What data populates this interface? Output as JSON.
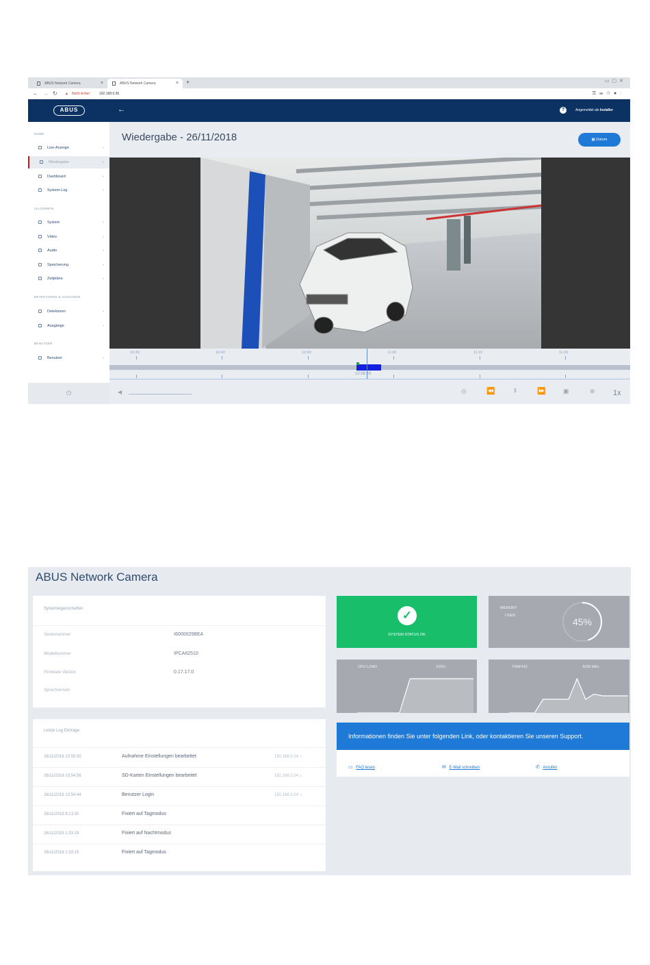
{
  "browser": {
    "tabs": [
      {
        "label": "ABUS Network Camera",
        "close": "×"
      },
      {
        "label": "ABUS Network Camera",
        "close": "×"
      }
    ],
    "new_tab": "+",
    "insecure_label": "Nicht sicher",
    "url": "192.168.0.36"
  },
  "app": {
    "logo_text": "ABUS",
    "user_prefix": "Angemeldet als",
    "user_name": "Installer",
    "help_icon": "?",
    "page_title": "Wiedergabe - 26/11/2018",
    "date_button": "Datum",
    "sidebar": {
      "sections": [
        {
          "title": "HOME",
          "items": [
            "Live-Anzeige",
            "Wiedergabe",
            "Dashboard",
            "System-Log"
          ]
        },
        {
          "title": "ALLGEMEIN",
          "items": [
            "System",
            "Video",
            "Audio",
            "Speicherung",
            "Zeitpläne"
          ]
        },
        {
          "title": "DETEKTOREN & AUSGÄNGE",
          "items": [
            "Detektoren",
            "Ausgänge"
          ]
        },
        {
          "title": "BENUTZER",
          "items": [
            "Benutzer"
          ]
        }
      ],
      "active_item": "Wiedergabe"
    },
    "timeline": {
      "ticks": [
        "10:30",
        "10:40",
        "10:50",
        "11:00",
        "11:10",
        "11:20"
      ],
      "current_time": "10:56:49"
    },
    "playback_speed": "1x"
  },
  "dashboard": {
    "title": "ABUS Network Camera",
    "properties": {
      "title": "Systemeigenschaften",
      "rows": [
        {
          "label": "Seriennummer",
          "value": "I6000029BEA"
        },
        {
          "label": "Modellnummer",
          "value": "IPCA62510"
        },
        {
          "label": "Firmware Version",
          "value": "0.17.17.0"
        },
        {
          "label": "Sprachversion",
          "value": ""
        }
      ]
    },
    "logs": {
      "title": "Letzte Log Einträge",
      "rows": [
        {
          "date": "26/11/2018 10:55:30",
          "text": "Aufnahme Einstellungen bearbeitet",
          "ip": "192.168.0.24"
        },
        {
          "date": "26/11/2018 10:54:56",
          "text": "SD-Karten Einstellungen bearbeitet",
          "ip": "192.168.0.24"
        },
        {
          "date": "26/11/2018 10:54:44",
          "text": "Benutzer Login",
          "ip": "192.168.0.24"
        },
        {
          "date": "26/11/2018 9:13:30",
          "text": "Fixiert auf Tagmodus",
          "ip": ""
        },
        {
          "date": "26/11/2018 1:33:19",
          "text": "Fixiert auf Nachtmodus",
          "ip": ""
        },
        {
          "date": "26/11/2018 1:33:15",
          "text": "Fixiert auf Tagmodus",
          "ip": ""
        }
      ]
    },
    "status": {
      "label": "SYSTEM STATUS OK",
      "color": "#19be6b"
    },
    "memory": {
      "label_line1": "MEMORY",
      "label_line2": "USED",
      "value": "45%",
      "percent": 45
    },
    "cpu": {
      "label": "CPU LOAD",
      "value": "100%",
      "chart_values": [
        0,
        0,
        0,
        0,
        0,
        100,
        100,
        100,
        100,
        100,
        100,
        100
      ]
    },
    "traffic": {
      "label": "TRAFFIC",
      "value": "4336 kB/s",
      "chart_values": [
        0,
        0,
        0,
        0,
        40,
        40,
        40,
        40,
        100,
        40,
        55,
        50,
        50,
        50,
        50
      ]
    },
    "support": {
      "message": "Informationen finden Sie unter folgenden Link, oder kontaktieren Sie unseren Support.",
      "links": [
        "FAQ lesen",
        "E-Mail schreiben",
        "Anrufen"
      ]
    }
  }
}
